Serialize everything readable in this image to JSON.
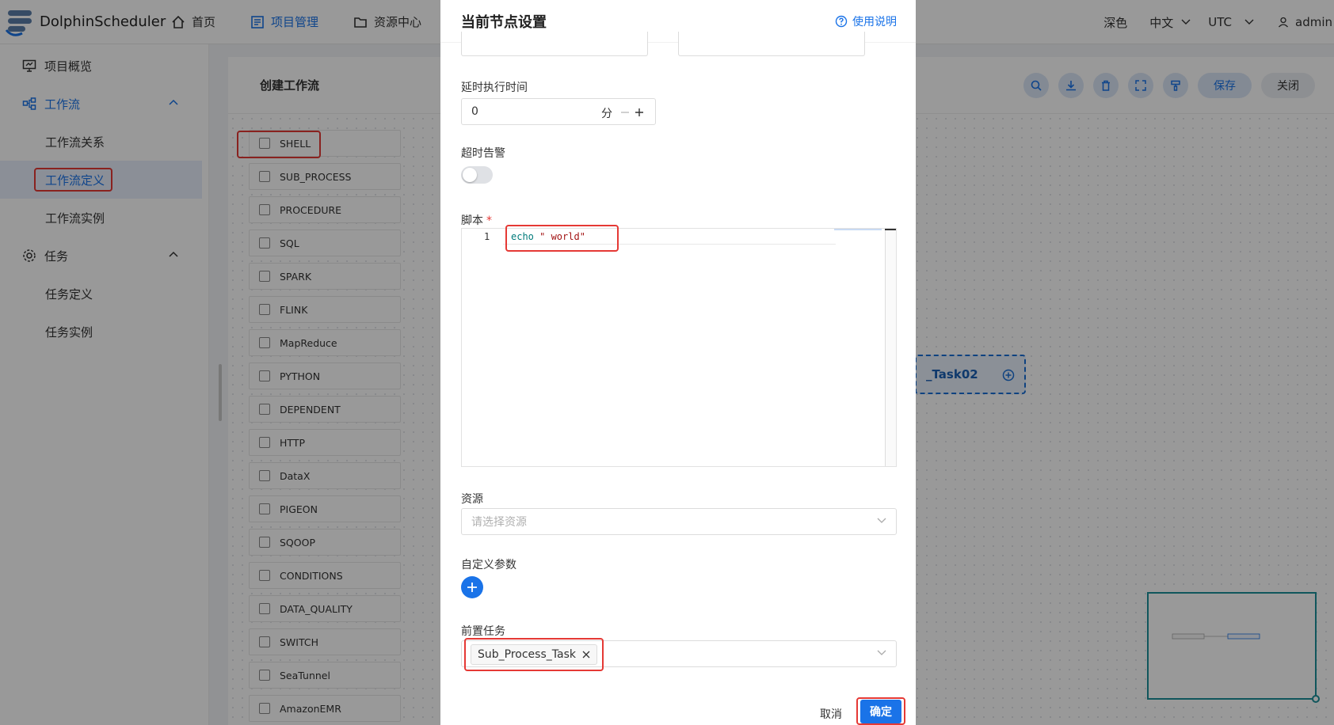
{
  "app": {
    "name": "DolphinScheduler"
  },
  "topnav": [
    {
      "label": "首页",
      "icon": "home-icon"
    },
    {
      "label": "项目管理",
      "icon": "project-icon",
      "active": true
    },
    {
      "label": "资源中心",
      "icon": "folder-icon"
    }
  ],
  "header_right": {
    "theme": "深色",
    "language": "中文",
    "timezone": "UTC",
    "user": "admin"
  },
  "sidebar": {
    "overview": "项目概览",
    "workflow_group": "工作流",
    "workflow_items": [
      "工作流关系",
      "工作流定义",
      "工作流实例"
    ],
    "task_group": "任务",
    "task_items": [
      "任务定义",
      "任务实例"
    ]
  },
  "canvas": {
    "title": "创建工作流",
    "save_label": "保存",
    "close_label": "关闭",
    "node_label": "_Task02",
    "palette": [
      "SHELL",
      "SUB_PROCESS",
      "PROCEDURE",
      "SQL",
      "SPARK",
      "FLINK",
      "MapReduce",
      "PYTHON",
      "DEPENDENT",
      "HTTP",
      "DataX",
      "PIGEON",
      "SQOOP",
      "CONDITIONS",
      "DATA_QUALITY",
      "SWITCH",
      "SeaTunnel",
      "AmazonEMR"
    ]
  },
  "drawer": {
    "title": "当前节点设置",
    "help": "使用说明",
    "delay_label": "延时执行时间",
    "delay_value": "0",
    "delay_unit": "分",
    "timeout_label": "超时告警",
    "script_label": "脚本",
    "required_mark": "*",
    "script_line_no": "1",
    "script_kw": "echo",
    "script_str": " \" world\"",
    "resource_label": "资源",
    "resource_placeholder": "请选择资源",
    "custom_params_label": "自定义参数",
    "pre_task_label": "前置任务",
    "pre_task_tag": "Sub_Process_Task",
    "cancel_label": "取消",
    "confirm_label": "确定"
  },
  "colors": {
    "primary": "#1a73e8",
    "highlight": "#e53935",
    "minimap": "#1b8f9a"
  }
}
